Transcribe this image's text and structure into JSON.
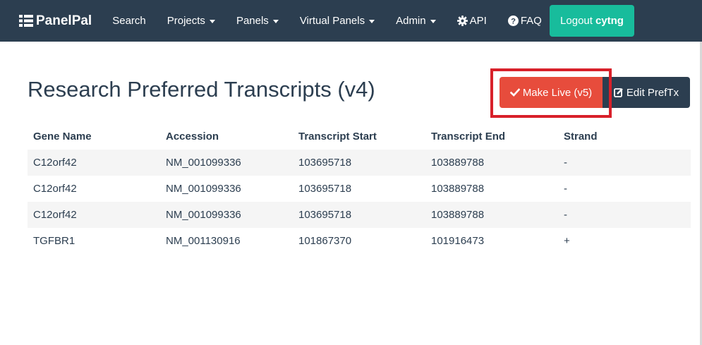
{
  "navbar": {
    "brand": "PanelPal",
    "brand_icon": "list-icon",
    "items": [
      {
        "label": "Search",
        "dropdown": false
      },
      {
        "label": "Projects",
        "dropdown": true
      },
      {
        "label": "Panels",
        "dropdown": true
      },
      {
        "label": "Virtual Panels",
        "dropdown": true
      },
      {
        "label": "Admin",
        "dropdown": true
      },
      {
        "label": "API",
        "icon": "gear-icon"
      },
      {
        "label": "FAQ",
        "icon": "question-circle-icon"
      }
    ],
    "logout_prefix": "Logout",
    "username": "cytng",
    "colors": {
      "navbar_bg": "#2c3e50",
      "logout_bg": "#18bc9c"
    }
  },
  "page": {
    "title": "Research Preferred Transcripts (v4)"
  },
  "actions": {
    "make_live_label": "Make Live (v5)",
    "make_live_icon": "check-icon",
    "edit_label": "Edit PrefTx",
    "edit_icon": "edit-icon",
    "colors": {
      "make_live_bg": "#e74c3c",
      "edit_bg": "#2c3e50",
      "highlight_border": "#d8202a"
    }
  },
  "table": {
    "headers": [
      "Gene Name",
      "Accession",
      "Transcript Start",
      "Transcript End",
      "Strand"
    ],
    "rows": [
      [
        "C12orf42",
        "NM_001099336",
        "103695718",
        "103889788",
        "-"
      ],
      [
        "C12orf42",
        "NM_001099336",
        "103695718",
        "103889788",
        "-"
      ],
      [
        "C12orf42",
        "NM_001099336",
        "103695718",
        "103889788",
        "-"
      ],
      [
        "TGFBR1",
        "NM_001130916",
        "101867370",
        "101916473",
        "+"
      ]
    ]
  }
}
